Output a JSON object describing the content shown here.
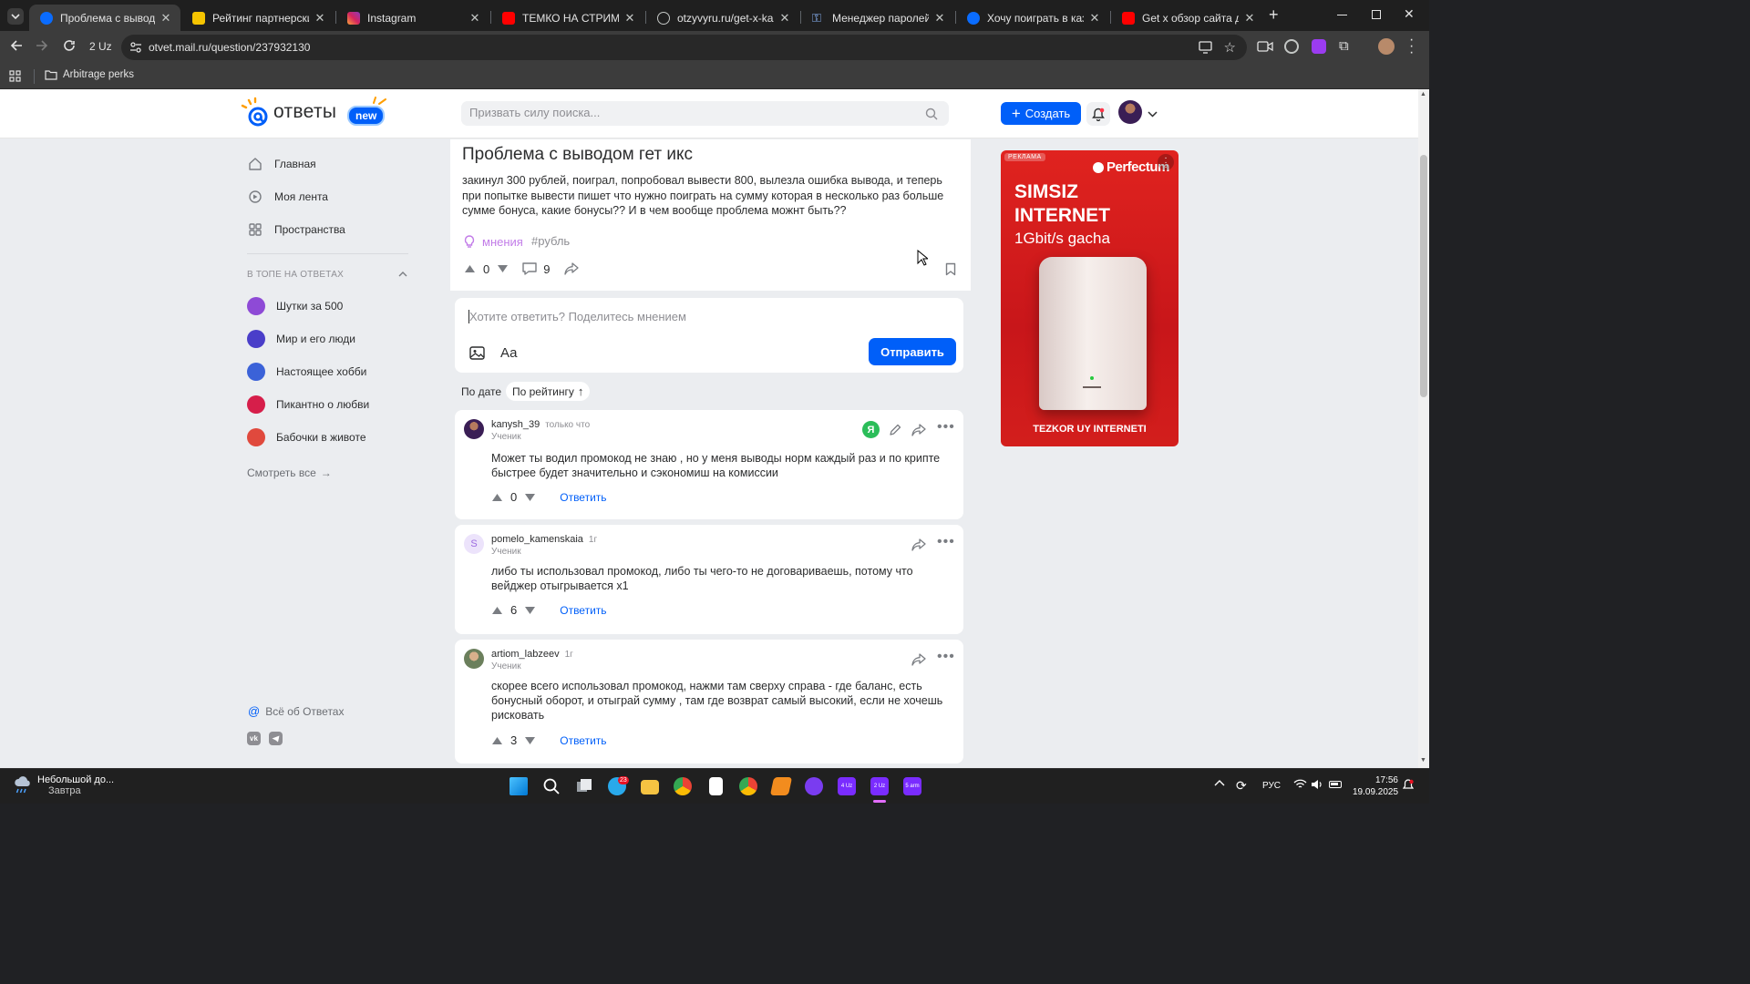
{
  "browser": {
    "tabs": [
      {
        "title": "Проблема с выводом гет",
        "active": true
      },
      {
        "title": "Рейтинг партнерских пр"
      },
      {
        "title": "Instagram"
      },
      {
        "title": "ТЕМКО НА СТРИМЕ ЗАШ"
      },
      {
        "title": "otzyvyru.ru/get-x-kazino"
      },
      {
        "title": "Менеджер паролей"
      },
      {
        "title": "Хочу поиграть в казино"
      },
      {
        "title": "Get x обзор сайта для но"
      }
    ],
    "new_tab": "+",
    "profile_badge": "2 Uz",
    "url": "otvet.mail.ru/question/237932130",
    "bookmark_folder": "Arbitrage perks"
  },
  "header": {
    "logo_text": "ответы",
    "logo_badge": "new",
    "search_placeholder": "Призвать силу поиска...",
    "create_label": "Создать"
  },
  "sidebar": {
    "nav": [
      {
        "label": "Главная",
        "icon": "home-icon"
      },
      {
        "label": "Моя лента",
        "icon": "feed-icon"
      },
      {
        "label": "Пространства",
        "icon": "spaces-icon"
      }
    ],
    "top_title": "В ТОПЕ НА ОТВЕТАХ",
    "top_items": [
      {
        "label": "Шутки за 500",
        "color": "#8e4ad6"
      },
      {
        "label": "Мир и его люди",
        "color": "#4a3ec9"
      },
      {
        "label": "Настоящее хобби",
        "color": "#3b62d8"
      },
      {
        "label": "Пикантно о любви",
        "color": "#d61e4a"
      },
      {
        "label": "Бабочки в животе",
        "color": "#e0493d"
      }
    ],
    "see_all": "Смотреть все",
    "about": "Всё об Ответах"
  },
  "question": {
    "title": "Проблема с выводом гет икс",
    "body": "закинул 300 рублей, поиграл, попробовал вывести 800, вылезла ошибка вывода, и теперь при попытке вывести пишет что нужно поиграть на сумму которая в несколько раз больше сумме бонуса, какие бонусы?? И в чем вообще проблема можнт быть??",
    "tag_category": "мнения",
    "tag_hash": "#рубль",
    "votes": "0",
    "comments": "9"
  },
  "answer_box": {
    "placeholder": "Хотите ответить? Поделитесь мнением",
    "font_label": "Аа",
    "send_label": "Отправить"
  },
  "sort": {
    "by_date": "По дате",
    "by_rating": "По рейтингу"
  },
  "answers": [
    {
      "user": "kanysh_39",
      "time": "только что",
      "rank": "Ученик",
      "text": "Может ты водил промокод не знаю , но у меня выводы норм каждый раз и по крипте быстрее будет значительно и сэкономиш на комиссии",
      "votes": "0",
      "reply": "Ответить",
      "avatar_color": "#5a3b7a",
      "badge": "Я"
    },
    {
      "user": "pomelo_kamenskaia",
      "time": "1г",
      "rank": "Ученик",
      "text": "либо ты использовал промокод, либо ты чего-то не договариваешь, потому что вейджер отыгрывается х1",
      "votes": "6",
      "reply": "Ответить",
      "avatar_color": "#ece3fb",
      "avatar_letter": "S"
    },
    {
      "user": "artiom_labzeev",
      "time": "1г",
      "rank": "Ученик",
      "text": "скорее всего использовал промокод, нажми там сверху справа - где баланс, есть бонусный оборот, и отыграй сумму , там где возврат самый высокий, если не хочешь рисковать",
      "votes": "3",
      "reply": "Ответить",
      "avatar_color": "#6b7f5c"
    }
  ],
  "ad": {
    "label": "РЕКЛАМА",
    "brand": "Perfectum",
    "line1": "SIMSIZ",
    "line2": "INTERNET",
    "line3": "1Gbit/s gacha",
    "footer": "TEZKOR UY INTERNETI"
  },
  "taskbar": {
    "weather_title": "Небольшой до...",
    "weather_sub": "Завтра",
    "lang": "РУС",
    "time": "17:56",
    "date": "19.09.2025",
    "badge_count": "23",
    "app_4uz": "4 Uz",
    "app_2uz": "2 Uz",
    "app_5arm": "5 arm"
  }
}
